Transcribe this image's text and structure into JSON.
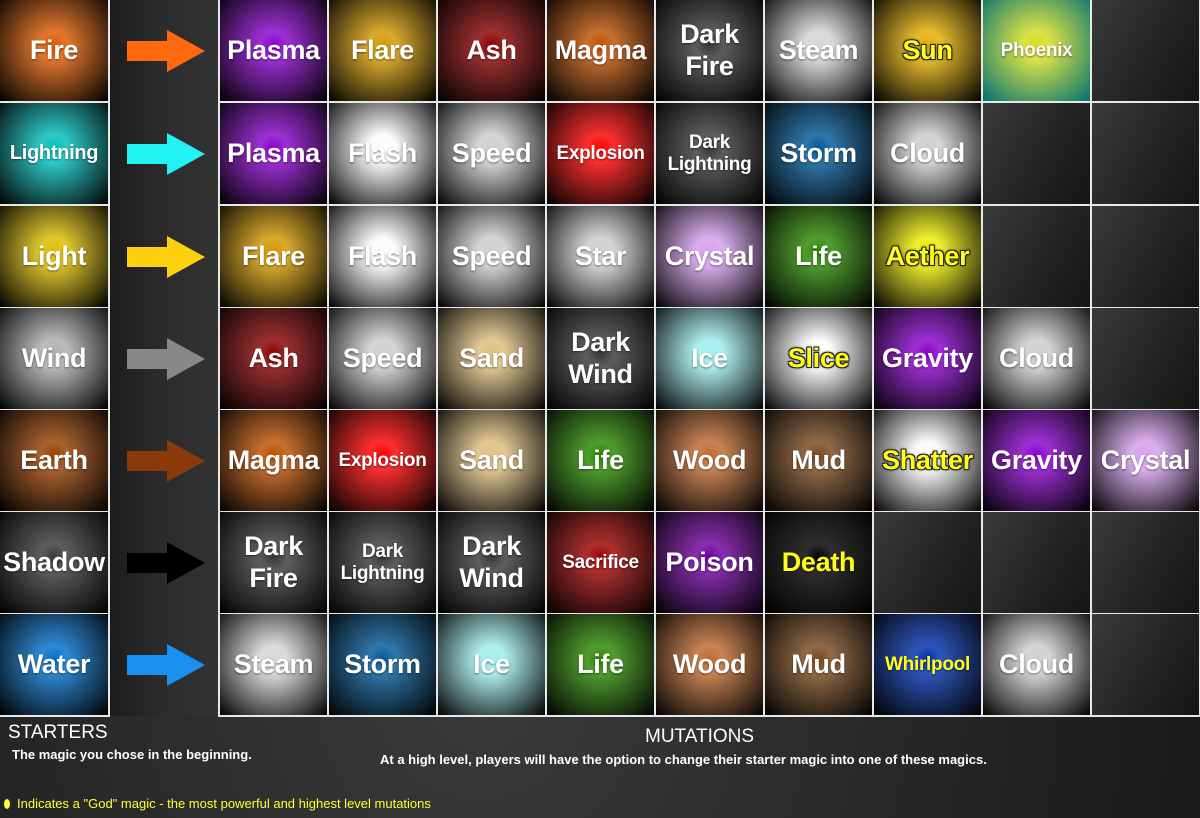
{
  "rows": [
    {
      "starter": {
        "name": "Fire",
        "color": "#e05a00"
      },
      "arrow_color": "#ff6a10",
      "mutations": [
        {
          "name": "Plasma",
          "color": "#8a00d0"
        },
        {
          "name": "Flare",
          "color": "#d69a00"
        },
        {
          "name": "Ash",
          "color": "#8a0000"
        },
        {
          "name": "Magma",
          "color": "#c05000"
        },
        {
          "name": "Dark Fire",
          "color": "#3a3a3a"
        },
        {
          "name": "Steam",
          "color": "#d8d8d8"
        },
        {
          "name": "Sun",
          "color": "#e8b000",
          "god": true
        },
        {
          "name": "Phoenix",
          "color": "#d8e020",
          "outer": "#007070"
        },
        {
          "name": "",
          "empty": true
        }
      ]
    },
    {
      "starter": {
        "name": "Lightning",
        "color": "#00c0c0"
      },
      "arrow_color": "#22f2f2",
      "mutations": [
        {
          "name": "Plasma",
          "color": "#8a00d0"
        },
        {
          "name": "Flash",
          "color": "#ffffff"
        },
        {
          "name": "Speed",
          "color": "#d0d0d0"
        },
        {
          "name": "Explosion",
          "color": "#ff0000"
        },
        {
          "name": "Dark Lightning",
          "color": "#3a3a3a"
        },
        {
          "name": "Storm",
          "color": "#005a9a"
        },
        {
          "name": "Cloud",
          "color": "#d0d0d0"
        },
        {
          "name": "",
          "empty": true
        },
        {
          "name": "",
          "empty": true
        }
      ]
    },
    {
      "starter": {
        "name": "Light",
        "color": "#e0c000"
      },
      "arrow_color": "#ffd010",
      "mutations": [
        {
          "name": "Flare",
          "color": "#d69a00"
        },
        {
          "name": "Flash",
          "color": "#ffffff"
        },
        {
          "name": "Speed",
          "color": "#d0d0d0"
        },
        {
          "name": "Star",
          "color": "#d0d0d0"
        },
        {
          "name": "Crystal",
          "color": "#d8a0f0"
        },
        {
          "name": "Life",
          "color": "#2a8a00"
        },
        {
          "name": "Aether",
          "color": "#f0f000",
          "god": true
        },
        {
          "name": "",
          "empty": true
        },
        {
          "name": "",
          "empty": true
        }
      ]
    },
    {
      "starter": {
        "name": "Wind",
        "color": "#b0b0b0"
      },
      "arrow_color": "#888888",
      "mutations": [
        {
          "name": "Ash",
          "color": "#8a0000"
        },
        {
          "name": "Speed",
          "color": "#d0d0d0"
        },
        {
          "name": "Sand",
          "color": "#e0c080"
        },
        {
          "name": "Dark Wind",
          "color": "#3a3a3a"
        },
        {
          "name": "Ice",
          "color": "#a0f0f0"
        },
        {
          "name": "Slice",
          "color": "#ffffff",
          "god": true
        },
        {
          "name": "Gravity",
          "color": "#8a00d0"
        },
        {
          "name": "Cloud",
          "color": "#d0d0d0"
        },
        {
          "name": "",
          "empty": true
        }
      ]
    },
    {
      "starter": {
        "name": "Earth",
        "color": "#9a4000"
      },
      "arrow_color": "#8a3a0a",
      "mutations": [
        {
          "name": "Magma",
          "color": "#c05000"
        },
        {
          "name": "Explosion",
          "color": "#ff0000"
        },
        {
          "name": "Sand",
          "color": "#e0c080"
        },
        {
          "name": "Life",
          "color": "#2a8a00"
        },
        {
          "name": "Wood",
          "color": "#c06a30"
        },
        {
          "name": "Mud",
          "color": "#7a4a20"
        },
        {
          "name": "Shatter",
          "color": "#ffffff",
          "god": true
        },
        {
          "name": "Gravity",
          "color": "#8a00d0"
        },
        {
          "name": "Crystal",
          "color": "#d8a0f0"
        }
      ]
    },
    {
      "starter": {
        "name": "Shadow",
        "color": "#3a3a3a"
      },
      "arrow_color": "#000000",
      "mutations": [
        {
          "name": "Dark Fire",
          "color": "#3a3a3a"
        },
        {
          "name": "Dark Lightning",
          "color": "#3a3a3a"
        },
        {
          "name": "Dark Wind",
          "color": "#3a3a3a"
        },
        {
          "name": "Sacrifice",
          "color": "#a00000"
        },
        {
          "name": "Poison",
          "color": "#7000a0"
        },
        {
          "name": "Death",
          "color": "#000000",
          "god_plain": true
        },
        {
          "name": "",
          "empty": true
        },
        {
          "name": "",
          "empty": true
        },
        {
          "name": "",
          "empty": true
        }
      ]
    },
    {
      "starter": {
        "name": "Water",
        "color": "#0070d0"
      },
      "arrow_color": "#1a90f0",
      "mutations": [
        {
          "name": "Steam",
          "color": "#d8d8d8"
        },
        {
          "name": "Storm",
          "color": "#005a9a"
        },
        {
          "name": "Ice",
          "color": "#a0f0f0"
        },
        {
          "name": "Life",
          "color": "#2a8a00"
        },
        {
          "name": "Wood",
          "color": "#c06a30"
        },
        {
          "name": "Mud",
          "color": "#7a4a20"
        },
        {
          "name": "Whirlpool",
          "color": "#0030b0",
          "god_plain": true
        },
        {
          "name": "Cloud",
          "color": "#d0d0d0"
        },
        {
          "name": "",
          "empty": true
        }
      ]
    }
  ],
  "footer": {
    "starters_title": "STARTERS",
    "starters_desc": "The magic you chose in the beginning.",
    "mutations_title": "MUTATIONS",
    "mutations_desc": "At a high level, players will have the option to change their starter magic into one of these magics.",
    "legend": "Indicates a \"God\" magic - the most powerful and highest level mutations"
  }
}
